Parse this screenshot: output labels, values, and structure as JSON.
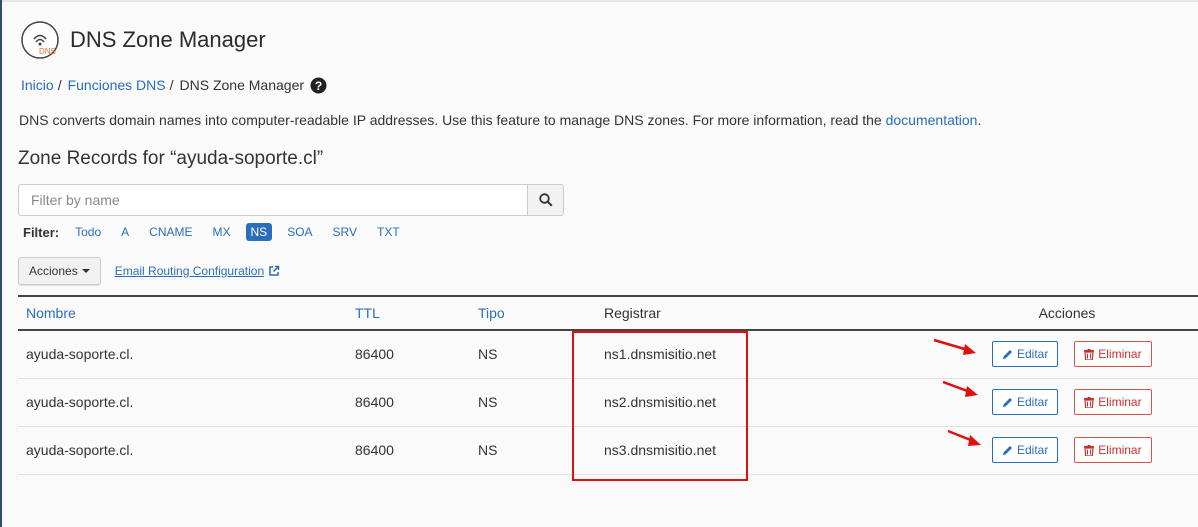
{
  "header": {
    "title": "DNS Zone Manager",
    "logo_text": "DNS"
  },
  "breadcrumb": {
    "home": "Inicio",
    "section": "Funciones DNS",
    "current": "DNS Zone Manager",
    "separator": "/"
  },
  "description": {
    "text": "DNS converts domain names into computer-readable IP addresses. Use this feature to manage DNS zones. For more information, read the ",
    "link": "documentation",
    "end": "."
  },
  "zone": {
    "title": "Zone Records for “ayuda-soporte.cl”"
  },
  "search": {
    "placeholder": "Filter by name",
    "value": ""
  },
  "filter": {
    "label": "Filter:",
    "options": [
      "Todo",
      "A",
      "CNAME",
      "MX",
      "NS",
      "SOA",
      "SRV",
      "TXT"
    ],
    "active": "NS"
  },
  "toolbar": {
    "actions_label": "Acciones",
    "email_routing": "Email Routing Configuration"
  },
  "table": {
    "columns": [
      "Nombre",
      "TTL",
      "Tipo",
      "Registrar",
      "Acciones"
    ],
    "rows": [
      {
        "name": "ayuda-soporte.cl.",
        "ttl": "86400",
        "type": "NS",
        "record": "ns1.dnsmisitio.net"
      },
      {
        "name": "ayuda-soporte.cl.",
        "ttl": "86400",
        "type": "NS",
        "record": "ns2.dnsmisitio.net"
      },
      {
        "name": "ayuda-soporte.cl.",
        "ttl": "86400",
        "type": "NS",
        "record": "ns3.dnsmisitio.net"
      }
    ],
    "edit_label": "Editar",
    "delete_label": "Eliminar"
  },
  "colors": {
    "link": "#2a6ebb",
    "danger": "#d9534f",
    "annotation": "#e01010"
  },
  "icons": [
    "dns-logo-icon",
    "help-icon",
    "search-icon",
    "external-link-icon",
    "pencil-icon",
    "trash-icon",
    "annotation-arrow-icon"
  ]
}
